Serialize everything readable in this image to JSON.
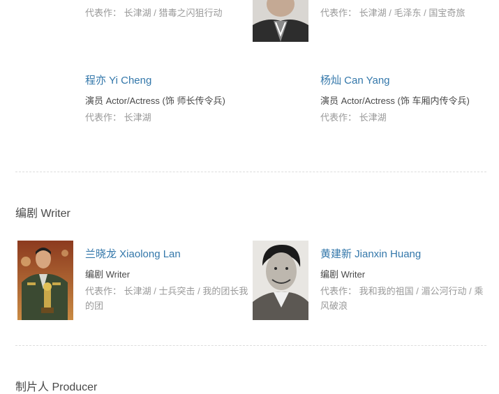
{
  "top_row": {
    "left": {
      "works_label": "代表作：",
      "works": [
        "长津湖",
        "猎毒之闪狙行动"
      ]
    },
    "right": {
      "works_label": "代表作：",
      "works": [
        "长津湖",
        "毛泽东",
        "国宝奇旅"
      ]
    }
  },
  "actors_row2": {
    "left": {
      "name": "程亦 Yi Cheng",
      "role": "演员 Actor/Actress (饰 师长传令兵)",
      "works_label": "代表作：",
      "works": [
        "长津湖"
      ]
    },
    "right": {
      "name": "杨灿 Can Yang",
      "role": "演员 Actor/Actress (饰 车厢内传令兵)",
      "works_label": "代表作：",
      "works": [
        "长津湖"
      ]
    }
  },
  "writer_section": {
    "title": "编剧 Writer",
    "left": {
      "name": "兰晓龙 Xiaolong Lan",
      "role": "编剧 Writer",
      "works_label": "代表作：",
      "works": [
        "长津湖",
        "士兵突击",
        "我的团长我的团"
      ]
    },
    "right": {
      "name": "黄建新 Jianxin Huang",
      "role": "编剧 Writer",
      "works_label": "代表作：",
      "works": [
        "我和我的祖国",
        "湄公河行动",
        "乘风破浪"
      ]
    }
  },
  "producer_section": {
    "title": "制片人 Producer"
  }
}
